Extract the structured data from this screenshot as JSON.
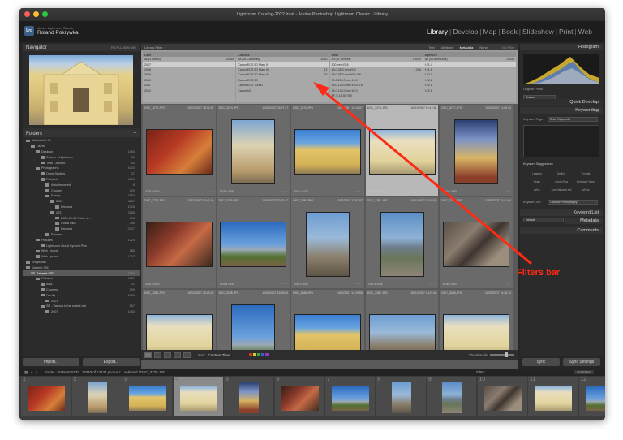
{
  "window": {
    "title": "Lightroom Catalog-2022.lrcat - Adobe Photoshop Lightroom Classic - Library"
  },
  "brand": {
    "app_name": "Adobe Lightroom Classic",
    "user_name": "Roland Pokrywka",
    "logo": "Lrc"
  },
  "modules": [
    "Library",
    "Develop",
    "Map",
    "Book",
    "Slideshow",
    "Print",
    "Web"
  ],
  "active_module": "Library",
  "left_panel": {
    "navigator_title": "Navigator",
    "navigator_zoom": "FIT  FILL  100%  50%",
    "folders_title": "Folders",
    "folders": [
      {
        "name": "Macintosh HD",
        "count": "",
        "level": 0,
        "selected": false
      },
      {
        "name": "Users",
        "count": "",
        "level": 1,
        "selected": false
      },
      {
        "name": "Desktop",
        "count": "1454",
        "level": 2,
        "selected": false
      },
      {
        "name": "Course - Lightroom",
        "count": "51",
        "level": 3,
        "selected": false
      },
      {
        "name": "Time - Advent",
        "count": "60",
        "level": 3,
        "selected": false
      },
      {
        "name": "Photographs",
        "count": "4424",
        "level": 2,
        "selected": false
      },
      {
        "name": "Open Studios",
        "count": "37",
        "level": 3,
        "selected": false
      },
      {
        "name": "Pictures",
        "count": "4034",
        "level": 3,
        "selected": false
      },
      {
        "name": "Auto Imported",
        "count": "8",
        "level": 4,
        "selected": false
      },
      {
        "name": "Courses",
        "count": "229",
        "level": 4,
        "selected": false
      },
      {
        "name": "Family",
        "count": "3183",
        "level": 4,
        "selected": false
      },
      {
        "name": "2022",
        "count": "1187",
        "level": 5,
        "selected": false
      },
      {
        "name": "Panama",
        "count": "1026",
        "level": 6,
        "selected": false
      },
      {
        "name": "2021",
        "count": "1156",
        "level": 5,
        "selected": false
      },
      {
        "name": "2022-02-19 Robin st...",
        "count": "145",
        "level": 6,
        "selected": false
      },
      {
        "name": "Costa Rica",
        "count": "756",
        "level": 6,
        "selected": false
      },
      {
        "name": "Panama",
        "count": "2027",
        "level": 6,
        "selected": false
      },
      {
        "name": "Panama",
        "count": "",
        "level": 4,
        "selected": false
      },
      {
        "name": "Pictures",
        "count": "1224",
        "level": 2,
        "selected": false
      },
      {
        "name": "Lightroom Cloud Synced Pics",
        "count": "",
        "level": 3,
        "selected": false
      },
      {
        "name": "Web - maps",
        "count": "188",
        "level": 2,
        "selected": false
      },
      {
        "name": "Web - pracz",
        "count": "1207",
        "level": 2,
        "selected": false
      },
      {
        "name": "Snapshots",
        "count": "",
        "level": 0,
        "selected": false
      },
      {
        "name": "Sabrent SSD",
        "count": "",
        "level": 0,
        "selected": false
      },
      {
        "name": "Sabrent SSD",
        "count": "1557",
        "level": 1,
        "selected": true
      },
      {
        "name": "Pictures",
        "count": "1557",
        "level": 2,
        "selected": false
      },
      {
        "name": "Asia",
        "count": "31",
        "level": 3,
        "selected": false
      },
      {
        "name": "Courses",
        "count": "299",
        "level": 3,
        "selected": false
      },
      {
        "name": "Family",
        "count": "1004",
        "level": 3,
        "selected": false
      },
      {
        "name": "2021",
        "count": "",
        "level": 4,
        "selected": false
      },
      {
        "name": "SR - Various to be sorted out",
        "count": "567",
        "level": 3,
        "selected": false
      },
      {
        "name": "2007",
        "count": "1054",
        "level": 4,
        "selected": false
      }
    ],
    "import_label": "Import...",
    "export_label": "Export..."
  },
  "library_filter": {
    "title": "Library Filter :",
    "options": [
      "Text",
      "Attribute",
      "Metadata",
      "None"
    ],
    "active": "Metadata",
    "preset": "No Filter",
    "columns": [
      {
        "header": "Date",
        "rows": [
          {
            "label": "All (4 Dates)",
            "count": "13040",
            "selected": false
          },
          {
            "label": "2007",
            "count": "",
            "selected": true
          },
          {
            "label": "2008",
            "count": "",
            "selected": false
          },
          {
            "label": "2009",
            "count": "",
            "selected": false
          },
          {
            "label": "2010",
            "count": "",
            "selected": false
          },
          {
            "label": "2011",
            "count": "",
            "selected": false
          },
          {
            "label": "2012",
            "count": "",
            "selected": false
          }
        ]
      },
      {
        "header": "Camera",
        "rows": [
          {
            "label": "All (26 Cameras)",
            "count": "13040",
            "selected": false
          },
          {
            "label": "Canon EOS 5D Mark II",
            "count": "",
            "selected": true
          },
          {
            "label": "Canon EOS 5D Mark III",
            "count": "12",
            "selected": false
          },
          {
            "label": "Canon EOS 5D Mark IV",
            "count": "33",
            "selected": false
          },
          {
            "label": "Canon EOS 5D",
            "count": "",
            "selected": false
          },
          {
            "label": "Canon EOS 7000D",
            "count": "",
            "selected": false
          },
          {
            "label": "Canon A3",
            "count": "",
            "selected": false
          }
        ]
      },
      {
        "header": "Lens",
        "rows": [
          {
            "label": "All (31 Lenses)",
            "count": "13040",
            "selected": false
          },
          {
            "label": "100 mm f/2.8",
            "count": "",
            "selected": true
          },
          {
            "label": "16.0-35.0 mm f/4.0",
            "count": "1246",
            "selected": false
          },
          {
            "label": "18.0-55.0 mm f/3.5-5.6",
            "count": "",
            "selected": false
          },
          {
            "label": "70.0-200.0 mm f/4.0",
            "count": "",
            "selected": false
          },
          {
            "label": "18.0-135.0 mm f/3.5-5.6",
            "count": "",
            "selected": false
          },
          {
            "label": "24.0-105.0 mm f/4.0",
            "count": "",
            "selected": false
          },
          {
            "label": "EF-S 18-55 IS II",
            "count": "",
            "selected": false
          }
        ]
      },
      {
        "header": "Aperture",
        "rows": [
          {
            "label": "All (43 Apertures)",
            "count": "13040",
            "selected": false
          },
          {
            "label": "f / 1.4",
            "count": "",
            "selected": true
          },
          {
            "label": "f / 1.8",
            "count": "",
            "selected": false
          },
          {
            "label": "f / 2.0",
            "count": "",
            "selected": false
          },
          {
            "label": "f / 2.2",
            "count": "",
            "selected": false
          },
          {
            "label": "f / 2.5",
            "count": "",
            "selected": false
          },
          {
            "label": "f / 2.8",
            "count": "",
            "selected": false
          }
        ]
      }
    ]
  },
  "grid": {
    "cells": [
      {
        "filename": "DSC_3272.JPG",
        "date": "10/01/2007 18:32:57",
        "size": "3008 x 2000",
        "thumb": "t-red",
        "selected": false,
        "w": 80,
        "h": 54
      },
      {
        "filename": "DSC_3274.JPG",
        "date": "10/01/2007 09:57:47",
        "size": "3008 x 2000",
        "thumb": "t-crucifix",
        "selected": false,
        "w": 52,
        "h": 78
      },
      {
        "filename": "DSC_3275.JPG",
        "date": "10/01/2007 10:10:07",
        "size": "3008 x 2000",
        "thumb": "t-church",
        "selected": false,
        "w": 80,
        "h": 54
      },
      {
        "filename": "DSC_3276.JPG",
        "date": "10/01/2007 10:12:38",
        "size": "3008 x 2000",
        "thumb": "t-facade",
        "selected": true,
        "w": 80,
        "h": 54
      },
      {
        "filename": "DSC_3277.JPG",
        "date": "10/01/2007 11:09:43",
        "size": "2000 x 3008",
        "thumb": "t-altar",
        "selected": false,
        "w": 52,
        "h": 78
      },
      {
        "filename": "DSC_3278.JPG",
        "date": "10/01/2007 10:41:04",
        "size": "3008 x 2000",
        "thumb": "t-interior",
        "selected": false,
        "w": 80,
        "h": 54
      },
      {
        "filename": "DSC_3279.JPG",
        "date": "10/01/2007 12:42:47",
        "size": "3008 x 2000",
        "thumb": "t-volcano",
        "selected": false,
        "w": 80,
        "h": 54
      },
      {
        "filename": "DSC_3280.JPG",
        "date": "10/01/2007 12:51:07",
        "size": "2000 x 3008",
        "thumb": "t-street",
        "selected": false,
        "w": 52,
        "h": 78
      },
      {
        "filename": "DSC_3281.JPG",
        "date": "10/01/2007 12:52:39",
        "size": "2000 x 3008",
        "thumb": "t-volcano2",
        "selected": false,
        "w": 52,
        "h": 78
      },
      {
        "filename": "DSC_3282.JPG",
        "date": "10/01/2007 13:01:04",
        "size": "3008 x 2000",
        "thumb": "t-sign",
        "selected": false,
        "w": 80,
        "h": 54
      },
      {
        "filename": "DSC_3284.JPG",
        "date": "10/01/2007 20:20:22",
        "size": "3008 x 2000",
        "thumb": "t-facade",
        "selected": false,
        "w": 80,
        "h": 54
      },
      {
        "filename": "DSC_3285.JPG",
        "date": "10/01/2007 13:05:00",
        "size": "2000 x 3008",
        "thumb": "t-volcano",
        "selected": false,
        "w": 52,
        "h": 78
      },
      {
        "filename": "DSC_3286.JPG",
        "date": "10/01/2007 13:10:55",
        "size": "3008 x 2000",
        "thumb": "t-church",
        "selected": false,
        "w": 80,
        "h": 54
      },
      {
        "filename": "DSC_3287.JPG",
        "date": "10/01/2007 14:21:06",
        "size": "3008 x 2000",
        "thumb": "t-street",
        "selected": false,
        "w": 80,
        "h": 54
      },
      {
        "filename": "DSC_3288.JPG",
        "date": "10/01/2007 14:26:12",
        "size": "3008 x 2000",
        "thumb": "t-facade",
        "selected": false,
        "w": 80,
        "h": 54
      }
    ]
  },
  "toolbar": {
    "sort_label": "Sort:",
    "sort_value": "Capture Time",
    "thumbnails_label": "Thumbnails"
  },
  "right_panel": {
    "histogram_title": "Histogram",
    "original_photo": "Original Photo",
    "quick_develop_title": "Quick Develop",
    "custom_label": "Custom",
    "keywording_title": "Keywording",
    "keyword_tags_label": "Keyword Tags",
    "keyword_tags_value": "Enter Keywords",
    "keyword_suggestions_title": "Keyword Suggestions",
    "suggestions": [
      "Leaders",
      "Selling",
      "Portrait",
      "Spain",
      "Costa Rica",
      "Embassy Wine",
      "Wine",
      "Anc Hathaert ent",
      "Whisk"
    ],
    "keyword_set_label": "Keyword Set",
    "keyword_set_value": "Outdoor Photography",
    "keyword_list_title": "Keyword List",
    "default_label": "Default",
    "metadata_title": "Metadata",
    "comments_title": "Comments",
    "sync_label": "Sync",
    "sync_settings_label": "Sync Settings"
  },
  "filmstrip_bar": {
    "source": "Folder : Sabrent SSD",
    "status": "13040 of 13537 photos / 1 selected / DSC_3276.JPG",
    "filter_label": "Filter :",
    "filter_value": "No Filter"
  },
  "filmstrip": {
    "items": [
      {
        "num": "1",
        "thumb": "t-red",
        "selected": false
      },
      {
        "num": "2",
        "thumb": "t-crucifix",
        "selected": false
      },
      {
        "num": "3",
        "thumb": "t-church",
        "selected": false
      },
      {
        "num": "4",
        "thumb": "t-facade",
        "selected": true
      },
      {
        "num": "5",
        "thumb": "t-altar",
        "selected": false
      },
      {
        "num": "6",
        "thumb": "t-interior",
        "selected": false
      },
      {
        "num": "7",
        "thumb": "t-volcano",
        "selected": false
      },
      {
        "num": "8",
        "thumb": "t-street",
        "selected": false
      },
      {
        "num": "9",
        "thumb": "t-volcano2",
        "selected": false
      },
      {
        "num": "10",
        "thumb": "t-sign",
        "selected": false
      },
      {
        "num": "11",
        "thumb": "t-facade",
        "selected": false
      },
      {
        "num": "12",
        "thumb": "t-volcano",
        "selected": false
      }
    ]
  },
  "annotation": {
    "label": "Filters bar",
    "color": "#ff2a16"
  },
  "colors": {
    "accent": "#ff2a16",
    "panel": "#2b2b2b",
    "grid": "#595959"
  }
}
